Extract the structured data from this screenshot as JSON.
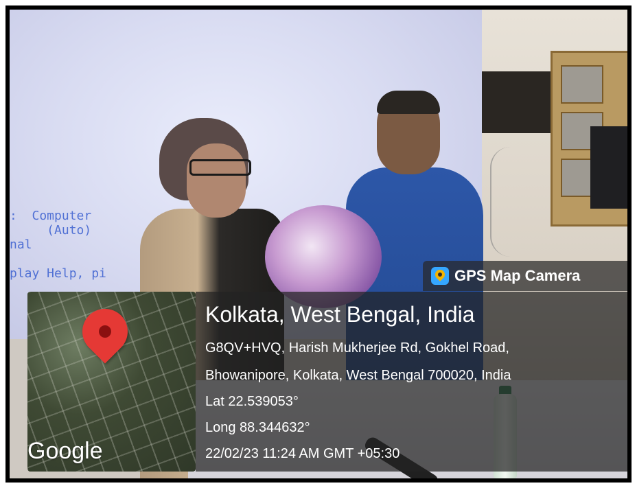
{
  "background_screen_text": ":  Computer\n     (Auto)\nnal\n\nplay Help, pi",
  "overlay": {
    "app_badge": {
      "label": "GPS Map Camera",
      "icon": "gps-map-camera-app-icon"
    },
    "map": {
      "watermark": "Google",
      "pin_icon": "location-pin-icon"
    },
    "location": {
      "title": "Kolkata, West Bengal, India",
      "address_line1": "G8QV+HVQ, Harish Mukherjee Rd, Gokhel Road,",
      "address_line2": "Bhowanipore, Kolkata, West Bengal 700020, India",
      "lat": "Lat 22.539053°",
      "long": "Long 88.344632°",
      "datetime": "22/02/23 11:24 AM GMT +05:30"
    }
  },
  "colors": {
    "overlay_bg": "#232323",
    "pin": "#e53935",
    "shirt": "#2d57a8"
  }
}
